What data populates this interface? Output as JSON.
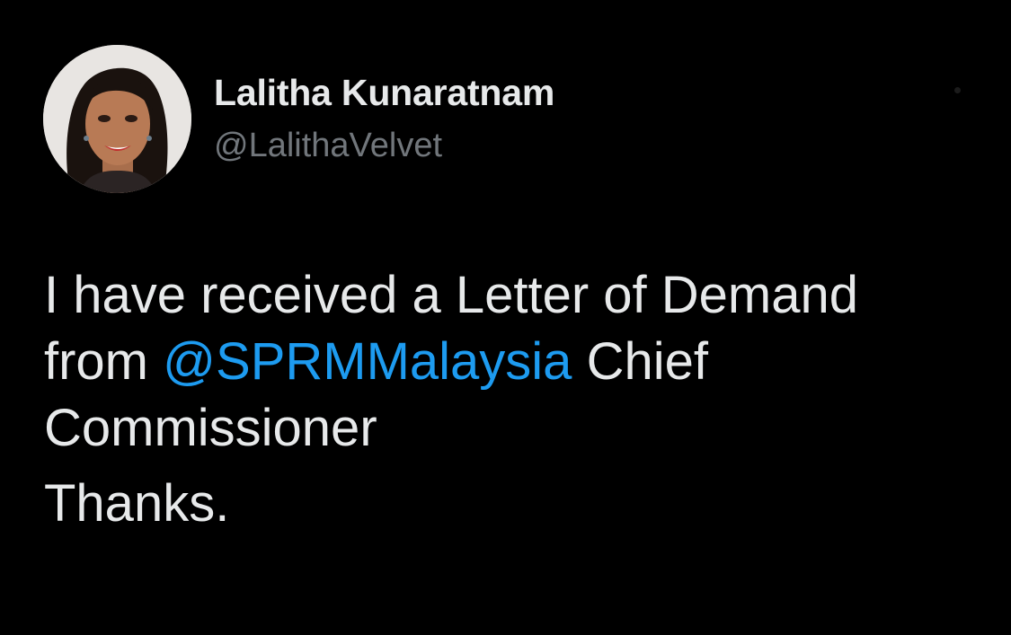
{
  "tweet": {
    "author": {
      "display_name": "Lalitha Kunaratnam",
      "handle": "@LalithaVelvet"
    },
    "more_icon": "more-options-icon",
    "text": {
      "line1": "I have received a Letter of Demand",
      "line2_prefix": "from",
      "mention": "@SPRMMalaysia",
      "line2_suffix": "Chief",
      "line3": "Commissioner",
      "paragraph2": "Thanks."
    },
    "colors": {
      "background": "#000000",
      "text": "#e7e9ea",
      "secondary_text": "#71767b",
      "mention": "#1d9bf0"
    }
  }
}
